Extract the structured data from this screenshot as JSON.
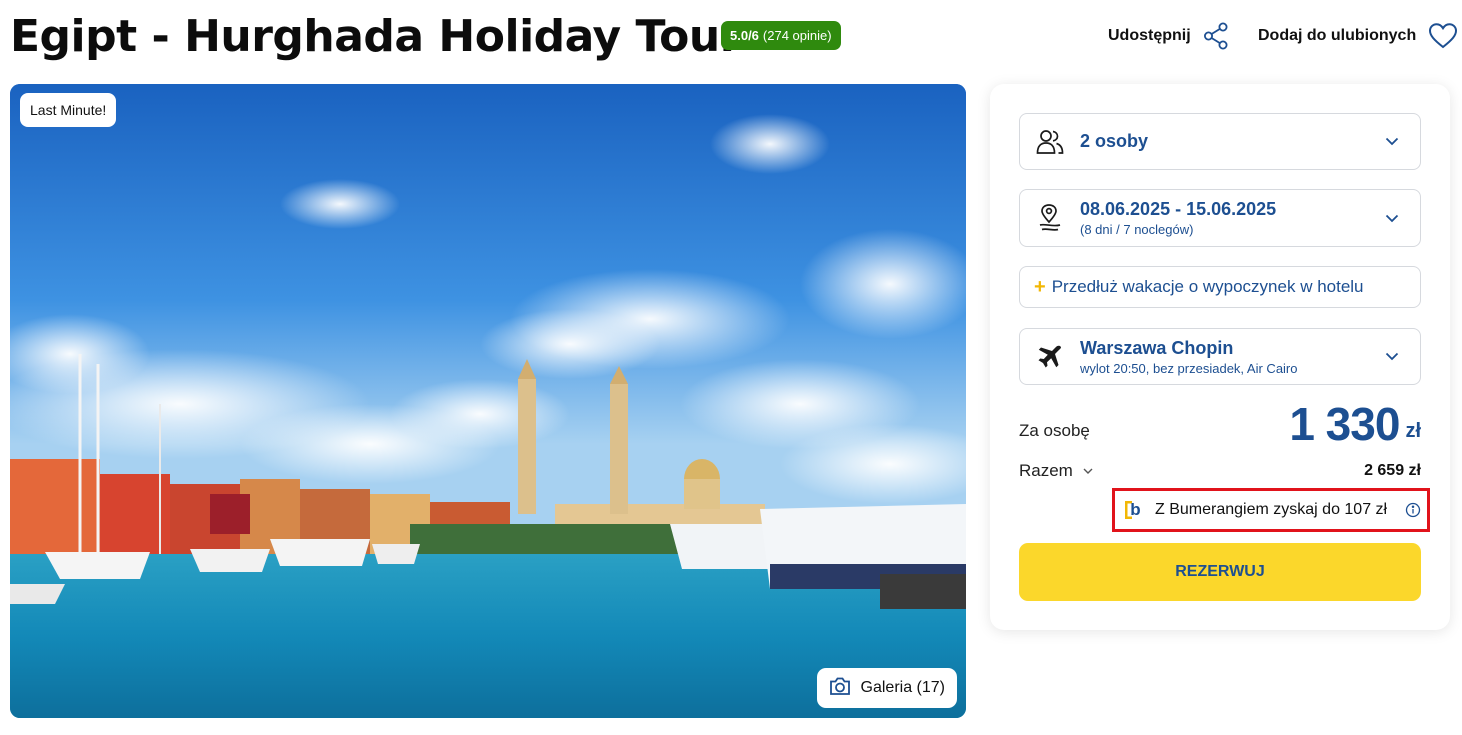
{
  "header": {
    "title": "Egipt - Hurghada Holiday Tour",
    "rating_score": "5.0/6",
    "rating_count": "(274 opinie)",
    "share_label": "Udostępnij",
    "favorite_label": "Dodaj do ulubionych",
    "rating_color": "#2f8a0e"
  },
  "hero": {
    "badge": "Last Minute!",
    "gallery_label": "Galeria (17)"
  },
  "booking": {
    "persons": {
      "label": "2 osoby",
      "icon": "users-icon"
    },
    "dates": {
      "label": "08.06.2025 - 15.06.2025",
      "sub": "(8 dni / 7 noclegów)",
      "icon": "location-calendar-icon"
    },
    "extend": {
      "label": "Przedłuż wakacje o wypoczynek w hotelu"
    },
    "flight": {
      "label": "Warszawa Chopin",
      "sub": "wylot 20:50, bez przesiadek, Air Cairo",
      "icon": "plane-icon"
    },
    "per_person_label": "Za osobę",
    "per_person_amount": "1 330",
    "currency": "zł",
    "total_label": "Razem",
    "total_value": "2 659 zł",
    "bumerang_logo": "b",
    "bumerang_text": "Z Bumerangiem zyskaj do 107 zł",
    "reserve_label": "REZERWUJ",
    "accent_color": "#1d4f91",
    "button_color": "#fbd72b",
    "highlight_color": "#e1131b"
  }
}
